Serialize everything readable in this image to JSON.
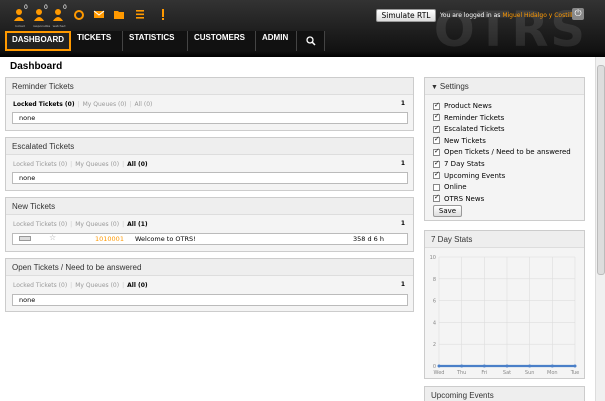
{
  "header": {
    "brand": "OTRS",
    "toolbar": [
      {
        "name": "locked-tickets-icon",
        "count": "0",
        "label": "locked"
      },
      {
        "name": "responsible-icon",
        "count": "0",
        "label": "responsible"
      },
      {
        "name": "watched-icon",
        "count": "0",
        "label": "watched"
      },
      {
        "name": "refresh-icon",
        "count": "",
        "label": ""
      },
      {
        "name": "email-icon",
        "count": "",
        "label": ""
      },
      {
        "name": "folder-icon",
        "count": "",
        "label": ""
      },
      {
        "name": "list-icon",
        "count": "",
        "label": ""
      },
      {
        "name": "alert-icon",
        "count": "",
        "label": ""
      }
    ],
    "simulate_rtl": "Simulate RTL",
    "logged_in_prefix": "You are logged in as",
    "user_name": "Miguel Hidalgo y Costilla",
    "logout": "⏻"
  },
  "nav": {
    "items": [
      "DASHBOARD",
      "TICKETS",
      "STATISTICS",
      "CUSTOMERS",
      "ADMIN"
    ]
  },
  "page": {
    "title": "Dashboard"
  },
  "reminder": {
    "title": "Reminder Tickets",
    "filters": [
      "Locked Tickets (0)",
      "My Queues (0)",
      "All (0)"
    ],
    "count": "1",
    "empty": "none"
  },
  "escalated": {
    "title": "Escalated Tickets",
    "filters": [
      "Locked Tickets (0)",
      "My Queues (0)",
      "All (0)"
    ],
    "count": "1",
    "empty": "none"
  },
  "newtickets": {
    "title": "New Tickets",
    "filters": [
      "Locked Tickets (0)",
      "My Queues (0)",
      "All (1)"
    ],
    "count": "1",
    "row": {
      "number": "1010001",
      "title": "Welcome to OTRS!",
      "age": "358 d 6 h"
    }
  },
  "open": {
    "title": "Open Tickets / Need to be answered",
    "filters": [
      "Locked Tickets (0)",
      "My Queues (0)",
      "All (0)"
    ],
    "count": "1",
    "empty": "none"
  },
  "settings": {
    "title": "Settings",
    "items": [
      {
        "label": "Product News",
        "checked": true
      },
      {
        "label": "Reminder Tickets",
        "checked": true
      },
      {
        "label": "Escalated Tickets",
        "checked": true
      },
      {
        "label": "New Tickets",
        "checked": true
      },
      {
        "label": "Open Tickets / Need to be answered",
        "checked": true
      },
      {
        "label": "7 Day Stats",
        "checked": true
      },
      {
        "label": "Upcoming Events",
        "checked": true
      },
      {
        "label": "Online",
        "checked": false
      },
      {
        "label": "OTRS News",
        "checked": true
      }
    ],
    "save": "Save"
  },
  "stats": {
    "title": "7 Day Stats"
  },
  "upcoming": {
    "title": "Upcoming Events"
  },
  "chart_data": {
    "type": "line",
    "title": "7 Day Stats",
    "categories": [
      "Wed",
      "Thu",
      "Fri",
      "Sat",
      "Sun",
      "Mon",
      "Tue"
    ],
    "series": [
      {
        "values": [
          0,
          0,
          0,
          0,
          0,
          0,
          0
        ],
        "color": "#4a7fc8"
      }
    ],
    "yticks": [
      "10",
      "8",
      "6",
      "4",
      "2",
      "0"
    ],
    "ylim": [
      0,
      10
    ],
    "grid": true
  }
}
